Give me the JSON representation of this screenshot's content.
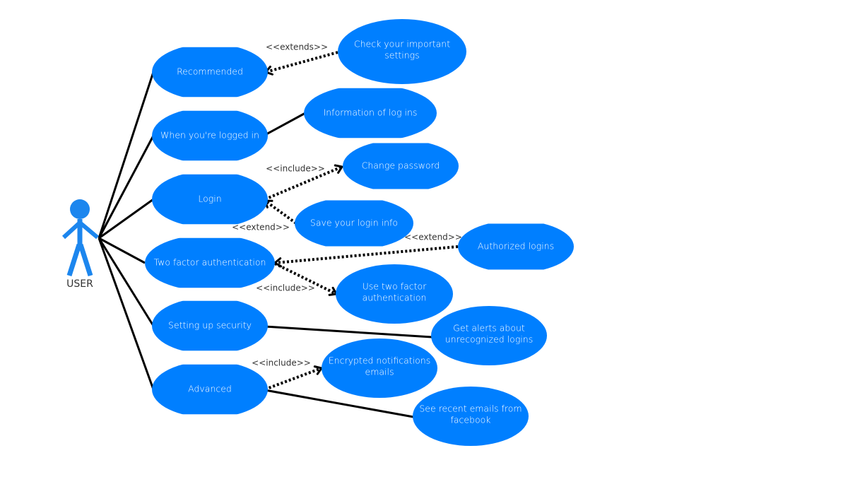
{
  "colors": {
    "usecase_fill": "#007FFF",
    "actor": "#1C86EE",
    "line": "#000000",
    "stereotype_text": "#333333"
  },
  "actor": {
    "label": "USER"
  },
  "use_cases": [
    {
      "id": "recommended",
      "lines": [
        "Recommended"
      ]
    },
    {
      "id": "logged-in",
      "lines": [
        "When you're logged in"
      ]
    },
    {
      "id": "login",
      "lines": [
        "Login"
      ]
    },
    {
      "id": "two-factor",
      "lines": [
        "Two factor authentication"
      ]
    },
    {
      "id": "setting-up-security",
      "lines": [
        "Setting up security"
      ]
    },
    {
      "id": "advanced",
      "lines": [
        "Advanced"
      ]
    },
    {
      "id": "check-settings",
      "lines": [
        "Check your important",
        "settings"
      ]
    },
    {
      "id": "info-logins",
      "lines": [
        "Information of log ins"
      ]
    },
    {
      "id": "change-password",
      "lines": [
        "Change password"
      ]
    },
    {
      "id": "save-login",
      "lines": [
        "Save your login info"
      ]
    },
    {
      "id": "authorized-logins",
      "lines": [
        "Authorized logins"
      ]
    },
    {
      "id": "use-two-factor",
      "lines": [
        "Use two factor",
        "authentication"
      ]
    },
    {
      "id": "get-alerts",
      "lines": [
        "Get alerts about",
        "unrecognized logins"
      ]
    },
    {
      "id": "encrypted-emails",
      "lines": [
        "Encrypted notifications",
        "emails"
      ]
    },
    {
      "id": "recent-emails",
      "lines": [
        "See recent emails from",
        "facebook"
      ]
    }
  ],
  "relationships": [
    {
      "type": "association",
      "from": "actor",
      "to": "recommended"
    },
    {
      "type": "association",
      "from": "actor",
      "to": "logged-in"
    },
    {
      "type": "association",
      "from": "actor",
      "to": "login"
    },
    {
      "type": "association",
      "from": "actor",
      "to": "two-factor"
    },
    {
      "type": "association",
      "from": "actor",
      "to": "setting-up-security"
    },
    {
      "type": "association",
      "from": "actor",
      "to": "advanced"
    },
    {
      "type": "extend",
      "from": "check-settings",
      "to": "recommended",
      "label": "<<extends>>"
    },
    {
      "type": "association",
      "from": "logged-in",
      "to": "info-logins"
    },
    {
      "type": "include",
      "from": "login",
      "to": "change-password",
      "label": "<<include>>"
    },
    {
      "type": "extend",
      "from": "save-login",
      "to": "login",
      "label": "<<extend>>"
    },
    {
      "type": "extend",
      "from": "authorized-logins",
      "to": "two-factor",
      "label": "<<extend>>"
    },
    {
      "type": "include",
      "from": "two-factor",
      "to": "use-two-factor",
      "label": "<<include>>"
    },
    {
      "type": "association",
      "from": "setting-up-security",
      "to": "get-alerts"
    },
    {
      "type": "include",
      "from": "advanced",
      "to": "encrypted-emails",
      "label": "<<include>>"
    },
    {
      "type": "association",
      "from": "advanced",
      "to": "recent-emails"
    }
  ]
}
